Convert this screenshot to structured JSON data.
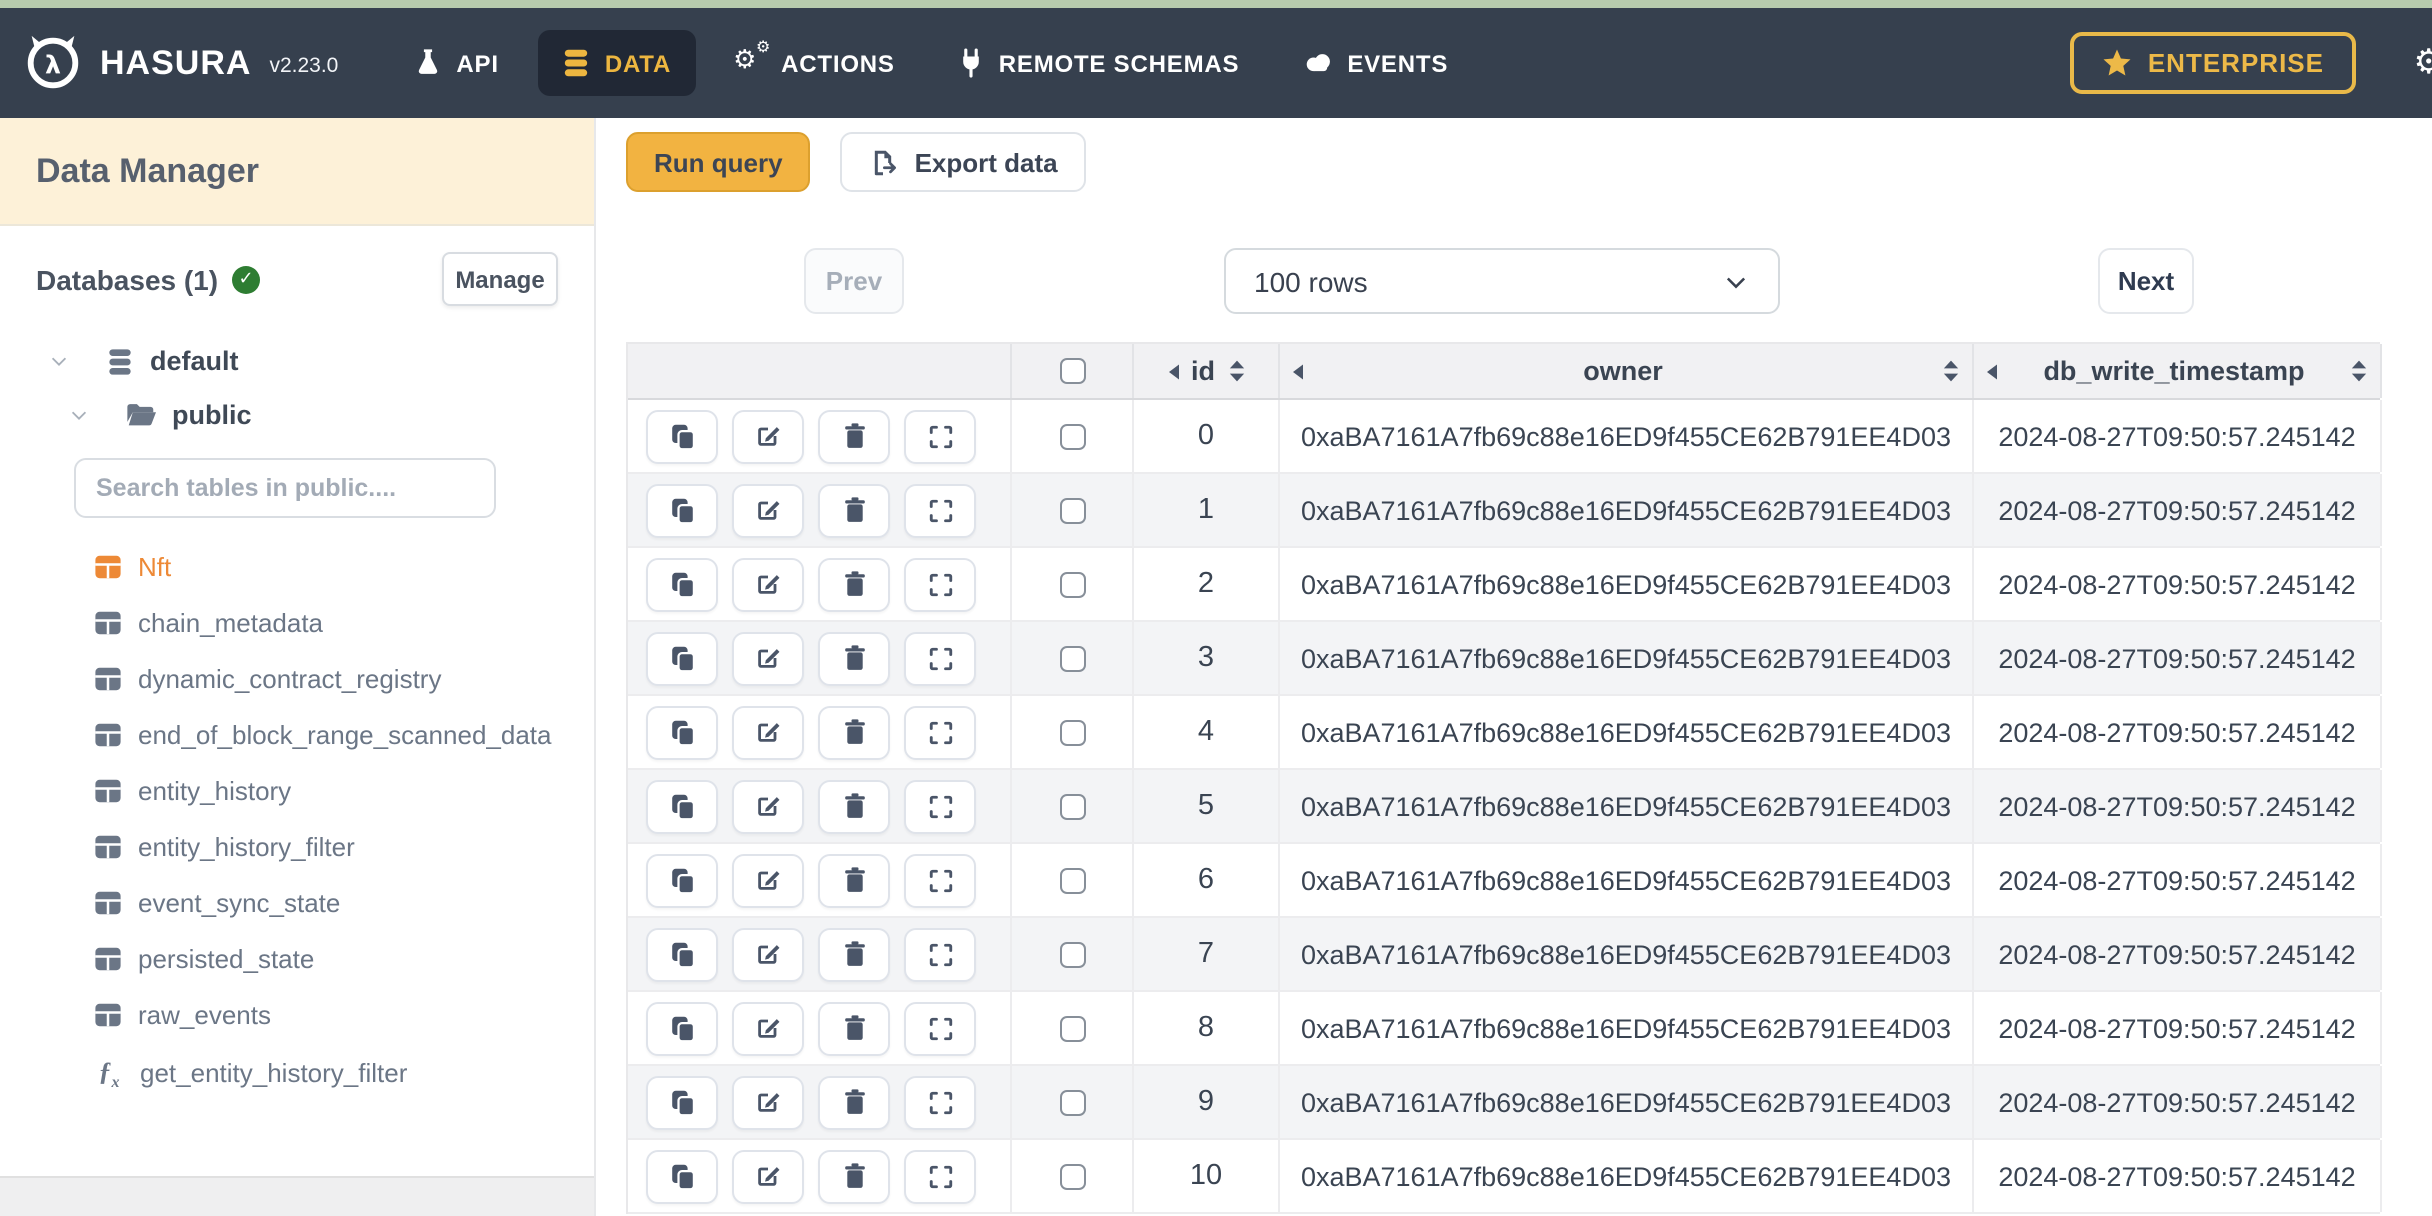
{
  "navbar": {
    "brand": "HASURA",
    "version": "v2.23.0",
    "items": [
      {
        "label": "API",
        "icon": "flask-icon",
        "active": false
      },
      {
        "label": "DATA",
        "icon": "database-icon",
        "active": true
      },
      {
        "label": "ACTIONS",
        "icon": "gears-icon",
        "active": false
      },
      {
        "label": "REMOTE SCHEMAS",
        "icon": "plug-icon",
        "active": false
      },
      {
        "label": "EVENTS",
        "icon": "cloud-icon",
        "active": false
      }
    ],
    "enterprise_label": "ENTERPRISE"
  },
  "sidebar": {
    "title": "Data Manager",
    "databases_label": "Databases (1)",
    "manage_button": "Manage",
    "database_name": "default",
    "schema_name": "public",
    "search_placeholder": "Search tables in public....",
    "active_table": "Nft",
    "tables": [
      "Nft",
      "chain_metadata",
      "dynamic_contract_registry",
      "end_of_block_range_scanned_data",
      "entity_history",
      "entity_history_filter",
      "event_sync_state",
      "persisted_state",
      "raw_events"
    ],
    "function_name": "get_entity_history_filter"
  },
  "toolbar": {
    "run_query_label": "Run query",
    "export_data_label": "Export data"
  },
  "pagination": {
    "prev_label": "Prev",
    "rows_select_value": "100 rows",
    "next_label": "Next"
  },
  "table": {
    "columns": [
      "id",
      "owner",
      "db_write_timestamp"
    ],
    "rows": [
      {
        "id": "0",
        "owner": "0xaBA7161A7fb69c88e16ED9f455CE62B791EE4D03",
        "db_write_timestamp": "2024-08-27T09:50:57.245142"
      },
      {
        "id": "1",
        "owner": "0xaBA7161A7fb69c88e16ED9f455CE62B791EE4D03",
        "db_write_timestamp": "2024-08-27T09:50:57.245142"
      },
      {
        "id": "2",
        "owner": "0xaBA7161A7fb69c88e16ED9f455CE62B791EE4D03",
        "db_write_timestamp": "2024-08-27T09:50:57.245142"
      },
      {
        "id": "3",
        "owner": "0xaBA7161A7fb69c88e16ED9f455CE62B791EE4D03",
        "db_write_timestamp": "2024-08-27T09:50:57.245142"
      },
      {
        "id": "4",
        "owner": "0xaBA7161A7fb69c88e16ED9f455CE62B791EE4D03",
        "db_write_timestamp": "2024-08-27T09:50:57.245142"
      },
      {
        "id": "5",
        "owner": "0xaBA7161A7fb69c88e16ED9f455CE62B791EE4D03",
        "db_write_timestamp": "2024-08-27T09:50:57.245142"
      },
      {
        "id": "6",
        "owner": "0xaBA7161A7fb69c88e16ED9f455CE62B791EE4D03",
        "db_write_timestamp": "2024-08-27T09:50:57.245142"
      },
      {
        "id": "7",
        "owner": "0xaBA7161A7fb69c88e16ED9f455CE62B791EE4D03",
        "db_write_timestamp": "2024-08-27T09:50:57.245142"
      },
      {
        "id": "8",
        "owner": "0xaBA7161A7fb69c88e16ED9f455CE62B791EE4D03",
        "db_write_timestamp": "2024-08-27T09:50:57.245142"
      },
      {
        "id": "9",
        "owner": "0xaBA7161A7fb69c88e16ED9f455CE62B791EE4D03",
        "db_write_timestamp": "2024-08-27T09:50:57.245142"
      },
      {
        "id": "10",
        "owner": "0xaBA7161A7fb69c88e16ED9f455CE62B791EE4D03",
        "db_write_timestamp": "2024-08-27T09:50:57.245142"
      }
    ]
  },
  "colors": {
    "navbar_bg": "#36404e",
    "accent_gold": "#edb640",
    "run_query_bg": "#f2b341",
    "sidebar_header_bg": "#fdf1d8",
    "active_table_orange": "#ED8936",
    "top_strip_green": "#b7cbad"
  }
}
